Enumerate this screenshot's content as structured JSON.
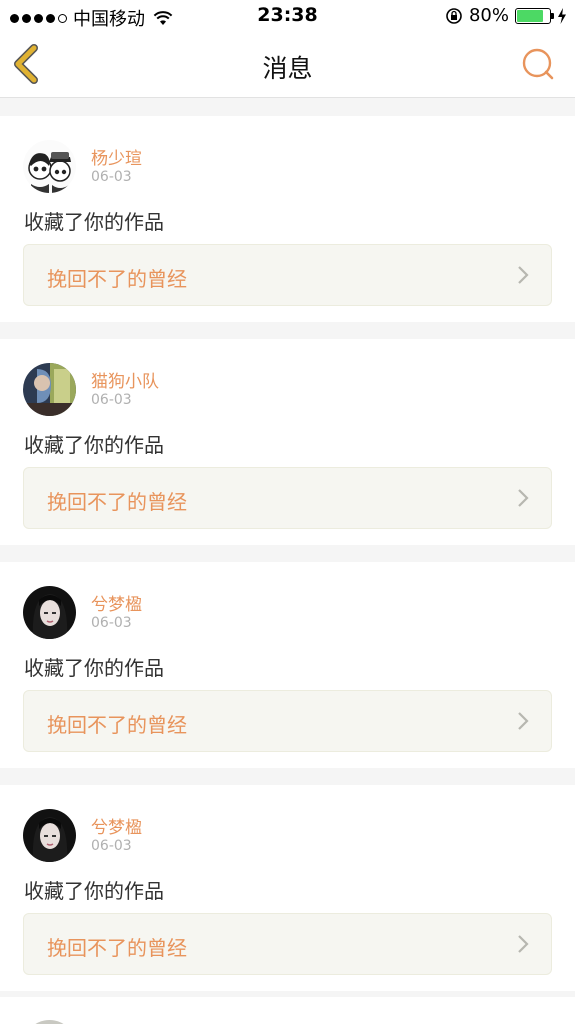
{
  "status_bar": {
    "carrier": "中国移动",
    "time": "23:38",
    "battery_percent": "80%",
    "battery_level": 0.8,
    "signal_bars": 4
  },
  "nav": {
    "title": "消息",
    "back_icon": "chevron-left-icon",
    "search_icon": "search-icon",
    "accent_color": "#e8945c",
    "back_color": "#e0b232"
  },
  "messages": [
    {
      "user": "杨少瑄",
      "time": "06-03",
      "action": "收藏了你的作品",
      "work": "挽回不了的曾经"
    },
    {
      "user": "猫狗小队",
      "time": "06-03",
      "action": "收藏了你的作品",
      "work": "挽回不了的曾经"
    },
    {
      "user": "兮梦楹",
      "time": "06-03",
      "action": "收藏了你的作品",
      "work": "挽回不了的曾经"
    },
    {
      "user": "兮梦楹",
      "time": "06-03",
      "action": "收藏了你的作品",
      "work": "挽回不了的曾经"
    }
  ]
}
